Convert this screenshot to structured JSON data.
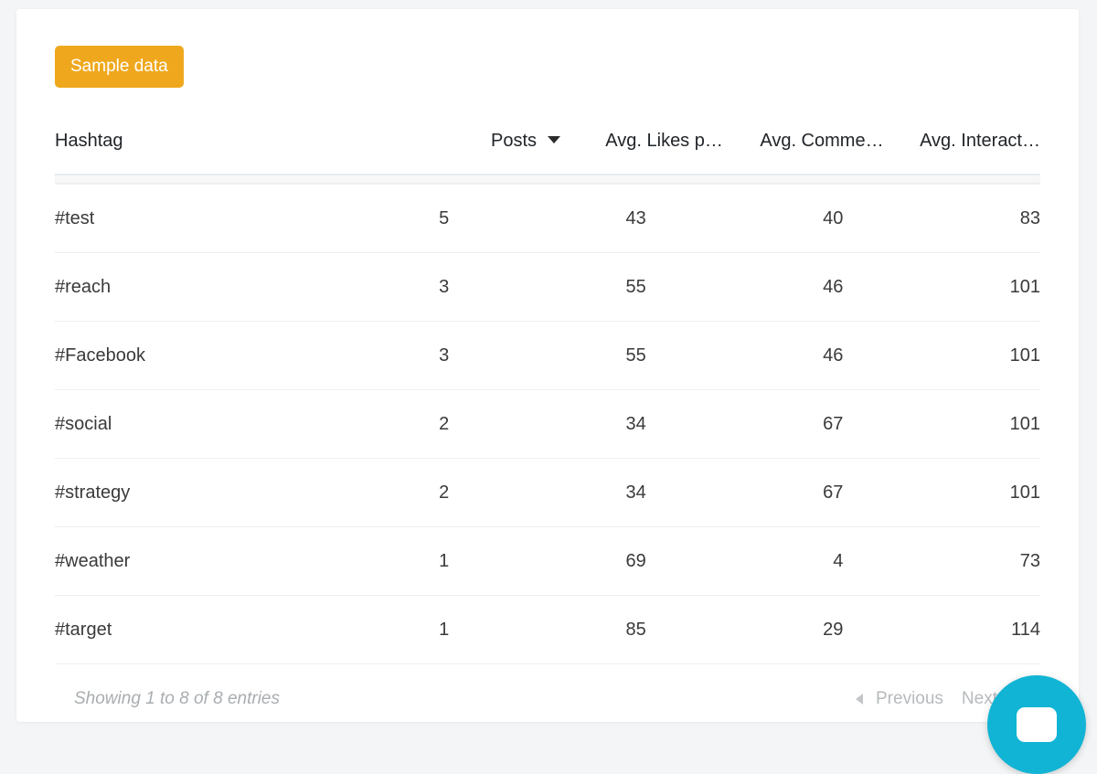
{
  "badge": {
    "label": "Sample data"
  },
  "table": {
    "columns": [
      {
        "key": "hashtag",
        "label": "Hashtag",
        "align": "left",
        "sorted": false
      },
      {
        "key": "posts",
        "label": "Posts",
        "align": "right",
        "sorted": true,
        "sort_direction": "desc"
      },
      {
        "key": "likes",
        "label": "Avg. Likes p…",
        "align": "right",
        "sorted": false
      },
      {
        "key": "comments",
        "label": "Avg. Comme…",
        "align": "right",
        "sorted": false
      },
      {
        "key": "inter",
        "label": "Avg. Interact…",
        "align": "right",
        "sorted": false
      }
    ],
    "rows": [
      {
        "hashtag": "#test",
        "posts": "5",
        "likes": "43",
        "comments": "40",
        "inter": "83"
      },
      {
        "hashtag": "#reach",
        "posts": "3",
        "likes": "55",
        "comments": "46",
        "inter": "101"
      },
      {
        "hashtag": "#Facebook",
        "posts": "3",
        "likes": "55",
        "comments": "46",
        "inter": "101"
      },
      {
        "hashtag": "#social",
        "posts": "2",
        "likes": "34",
        "comments": "67",
        "inter": "101"
      },
      {
        "hashtag": "#strategy",
        "posts": "2",
        "likes": "34",
        "comments": "67",
        "inter": "101"
      },
      {
        "hashtag": "#weather",
        "posts": "1",
        "likes": "69",
        "comments": "4",
        "inter": "73"
      },
      {
        "hashtag": "#target",
        "posts": "1",
        "likes": "85",
        "comments": "29",
        "inter": "114"
      }
    ]
  },
  "footer": {
    "showing": "Showing 1 to 8 of 8 entries",
    "previous_label": "Previous",
    "next_label": "Next"
  },
  "chat": {
    "icon": "chat-bubble-icon"
  },
  "colors": {
    "badge_orange": "#efa81d",
    "value_green": "#4f9a2d",
    "chat_cyan": "#11b4d4",
    "page_background": "#f3f5f6",
    "card_background": "#ffffff",
    "muted_text": "#a9adb0"
  }
}
